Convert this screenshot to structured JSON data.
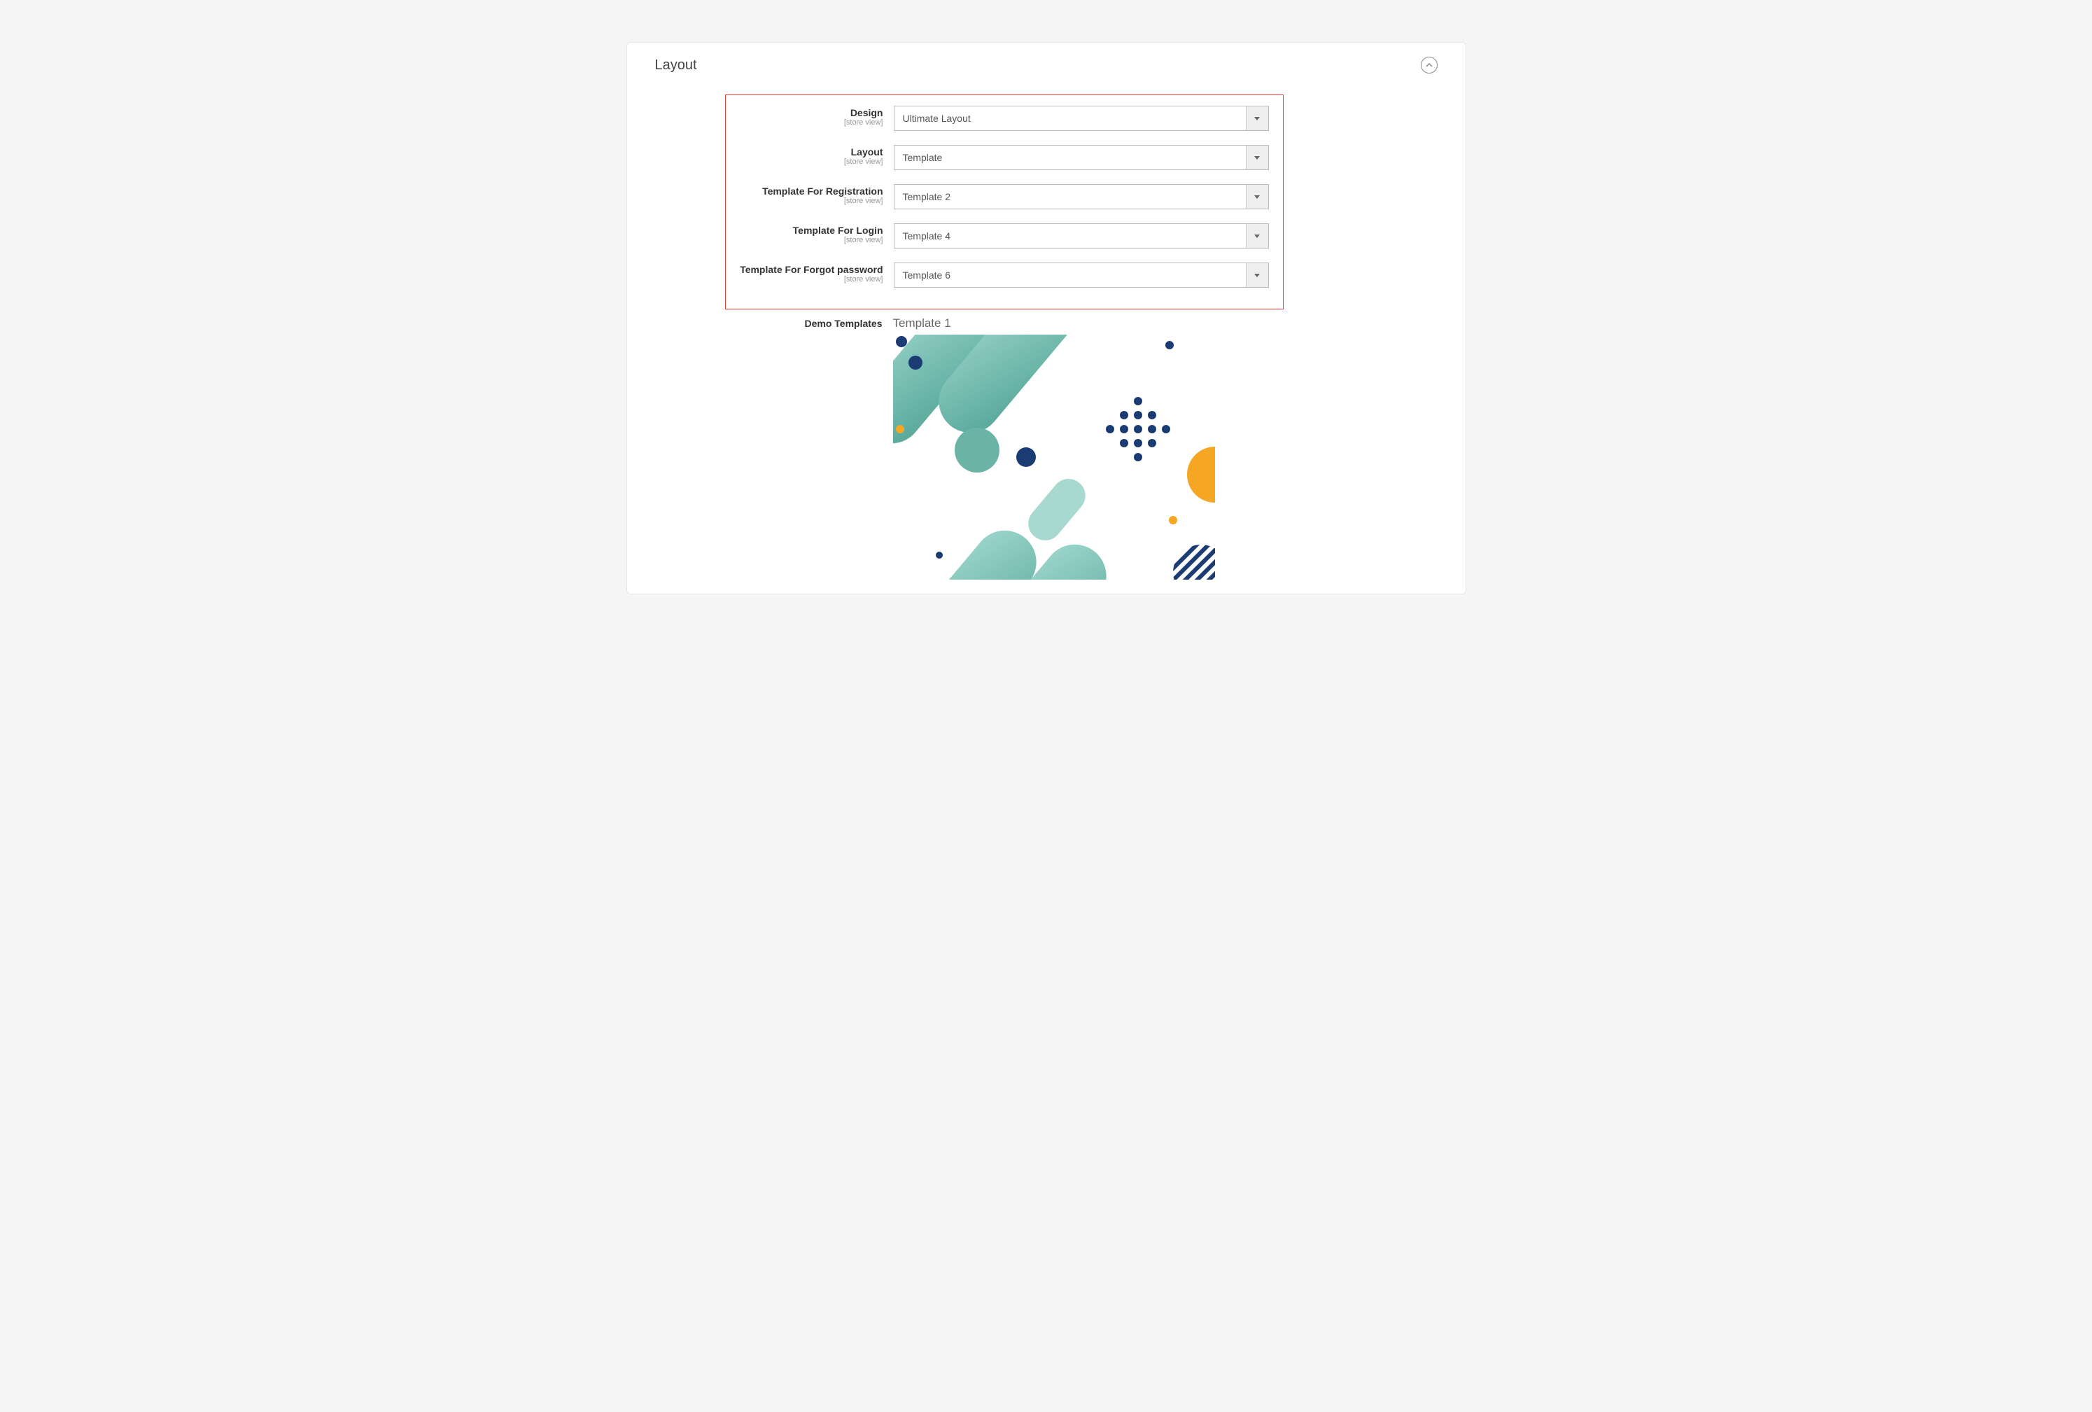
{
  "panel": {
    "title": "Layout"
  },
  "fields": {
    "design": {
      "label": "Design",
      "scope": "[store view]",
      "value": "Ultimate Layout"
    },
    "layout": {
      "label": "Layout",
      "scope": "[store view]",
      "value": "Template"
    },
    "tpl_reg": {
      "label": "Template For Registration",
      "scope": "[store view]",
      "value": "Template 2"
    },
    "tpl_login": {
      "label": "Template For Login",
      "scope": "[store view]",
      "value": "Template 4"
    },
    "tpl_forgot": {
      "label": "Template For Forgot password",
      "scope": "[store view]",
      "value": "Template 6"
    },
    "demo": {
      "label": "Demo Templates",
      "title": "Template 1"
    }
  }
}
